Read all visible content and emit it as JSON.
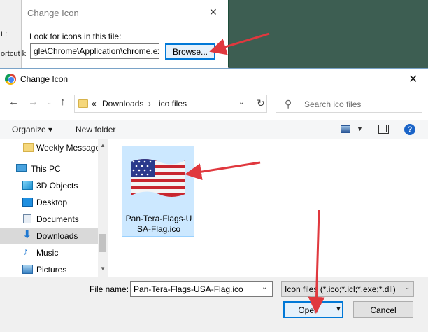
{
  "background_dialog": {
    "title": "Change Icon",
    "left_fragments": [
      "L:",
      "ortcut k"
    ],
    "look_label": "Look for icons in this file:",
    "path_value": "gle\\Chrome\\Application\\chrome.exe",
    "browse_label": "Browse..."
  },
  "dialog": {
    "title": "Change Icon",
    "address": {
      "overflow": "«",
      "crumbs": [
        "Downloads",
        "ico files"
      ],
      "separator": "›"
    },
    "search_placeholder": "Search ico files",
    "toolbar": {
      "organize": "Organize ▾",
      "new_folder": "New folder"
    },
    "nav_items": [
      {
        "label": "Weekly Message",
        "icon": "folder-icon"
      },
      {
        "label": "This PC",
        "icon": "computer-icon"
      },
      {
        "label": "3D Objects",
        "icon": "cube-icon"
      },
      {
        "label": "Desktop",
        "icon": "desktop-icon"
      },
      {
        "label": "Documents",
        "icon": "documents-icon"
      },
      {
        "label": "Downloads",
        "icon": "download-icon"
      },
      {
        "label": "Music",
        "icon": "music-icon"
      },
      {
        "label": "Pictures",
        "icon": "pictures-icon"
      }
    ],
    "file": {
      "name": "Pan-Tera-Flags-USA-Flag.ico",
      "display_name": "Pan-Tera-Flags-USA-Flag.ico",
      "icon": "us-flag-icon"
    },
    "file_name_label": "File name:",
    "file_name_value": "Pan-Tera-Flags-USA-Flag.ico",
    "file_type_value": "Icon files (*.ico;*.icl;*.exe;*.dll)",
    "open_label": "Open",
    "cancel_label": "Cancel"
  },
  "colors": {
    "annotation_arrow": "#e0383e",
    "selection": "#cce8ff",
    "accent": "#0078d7"
  }
}
